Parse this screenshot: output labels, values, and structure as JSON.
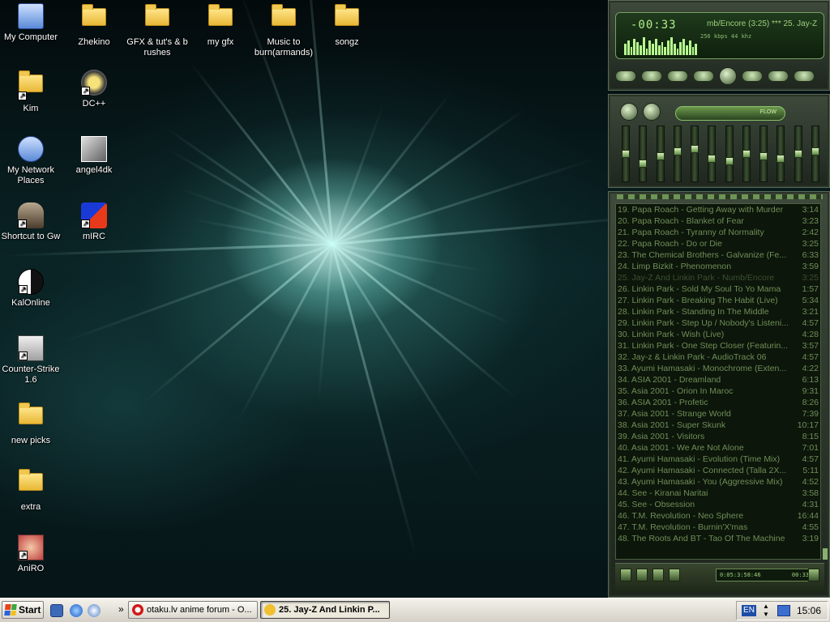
{
  "desktop": {
    "icons": [
      {
        "label": "My Computer",
        "icon": "computer-icon"
      },
      {
        "label": "Zhekino",
        "icon": "folder-icon"
      },
      {
        "label": "GFX & tut's & b rushes",
        "icon": "folder-icon"
      },
      {
        "label": "my gfx",
        "icon": "folder-icon"
      },
      {
        "label": "Music to burn(armands)",
        "icon": "folder-icon"
      },
      {
        "label": "songz",
        "icon": "folder-icon"
      },
      {
        "label": "Kim",
        "icon": "open-folder-icon"
      },
      {
        "label": "DC++",
        "icon": "dcpp-icon"
      },
      {
        "label": "My Network Places",
        "icon": "network-icon"
      },
      {
        "label": "angel4dk",
        "icon": "image-file-icon"
      },
      {
        "label": "Shortcut to Gw",
        "icon": "game-helmet-icon"
      },
      {
        "label": "mIRC",
        "icon": "mirc-icon"
      },
      {
        "label": "KalOnline",
        "icon": "yin-yang-icon"
      },
      {
        "label": "Counter-Strike 1.6",
        "icon": "counter-strike-icon"
      },
      {
        "label": "new picks",
        "icon": "folder-icon"
      },
      {
        "label": "extra",
        "icon": "folder-icon"
      },
      {
        "label": "AniRO",
        "icon": "anime-game-icon"
      }
    ]
  },
  "winamp": {
    "time": "-00:33",
    "marquee": "mb/Encore (3:25) *** 25. Jay-Z",
    "kbps": "256 kbps 44 khz",
    "eq_label": "FLOW",
    "eq_levels": [
      0.5,
      0.3,
      0.45,
      0.55,
      0.6,
      0.4,
      0.35,
      0.5,
      0.45,
      0.4,
      0.5,
      0.55
    ],
    "playlist_time": "0:05:3:58:46",
    "playlist_time_right": "00:33",
    "playlist": [
      {
        "title": "19. Papa Roach - Getting Away with Murder",
        "length": "3:14"
      },
      {
        "title": "20. Papa Roach - Blanket of Fear",
        "length": "3:23"
      },
      {
        "title": "21. Papa Roach - Tyranny of Normality",
        "length": "2:42"
      },
      {
        "title": "22. Papa Roach - Do or Die",
        "length": "3:25"
      },
      {
        "title": "23. The Chemical Brothers - Galvanize (Fe...",
        "length": "6:33"
      },
      {
        "title": "24. Limp Bizkit - Phenomenon",
        "length": "3:59"
      },
      {
        "title": "25. Jay-Z And Linkin Park - Numb/Encore",
        "length": "3:25",
        "current": true
      },
      {
        "title": "26. Linkin Park - Sold My Soul To Yo Mama",
        "length": "1:57"
      },
      {
        "title": "27. Linkin Park - Breaking The Habit (Live)",
        "length": "5:34"
      },
      {
        "title": "28. Linkin Park - Standing In The Middle",
        "length": "3:21"
      },
      {
        "title": "29. Linkin Park - Step Up / Nobody's Listeni...",
        "length": "4:57"
      },
      {
        "title": "30. Linkin Park - Wish (Live)",
        "length": "4:28"
      },
      {
        "title": "31. Linkin Park - One Step Closer (Featurin...",
        "length": "3:57"
      },
      {
        "title": "32. Jay-z & Linkin Park - AudioTrack 06",
        "length": "4:57"
      },
      {
        "title": "33. Ayumi Hamasaki - Monochrome (Exten...",
        "length": "4:22"
      },
      {
        "title": "34. ASIA 2001 - Dreamland",
        "length": "6:13"
      },
      {
        "title": "35. Asia 2001 - Orion In Maroc",
        "length": "9:31"
      },
      {
        "title": "36. ASIA 2001 - Profetic",
        "length": "8:26"
      },
      {
        "title": "37. Asia 2001 - Strange World",
        "length": "7:39"
      },
      {
        "title": "38. Asia 2001 - Super Skunk",
        "length": "10:17"
      },
      {
        "title": "39. Asia 2001 - Visitors",
        "length": "8:15"
      },
      {
        "title": "40. Asia 2001 - We Are Not Alone",
        "length": "7:01"
      },
      {
        "title": "41. Ayumi Hamasaki - Evolution (Time Mix)",
        "length": "4:57"
      },
      {
        "title": "42. Ayumi Hamasaki - Connected (Talla 2X...",
        "length": "5:11"
      },
      {
        "title": "43. Ayumi Hamasaki - You (Aggressive Mix)",
        "length": "4:52"
      },
      {
        "title": "44. See - Kiranai Naritai",
        "length": "3:58"
      },
      {
        "title": "45. See - Obsession",
        "length": "4:31"
      },
      {
        "title": "46. T.M. Revolution - Neo Sphere",
        "length": "16:44"
      },
      {
        "title": "47. T.M. Revolution - Burnin'X'mas",
        "length": "4:55"
      },
      {
        "title": "48. The Roots And BT - Tao Of The Machine",
        "length": "3:19"
      }
    ]
  },
  "taskbar": {
    "start_label": "Start",
    "tasks": [
      {
        "label": "otaku.lv anime forum - O...",
        "active": false
      },
      {
        "label": "25. Jay-Z And Linkin P...",
        "active": true
      }
    ],
    "quicklaunch_chevron": "»",
    "tray": {
      "language": "EN",
      "clock": "15:06"
    }
  }
}
